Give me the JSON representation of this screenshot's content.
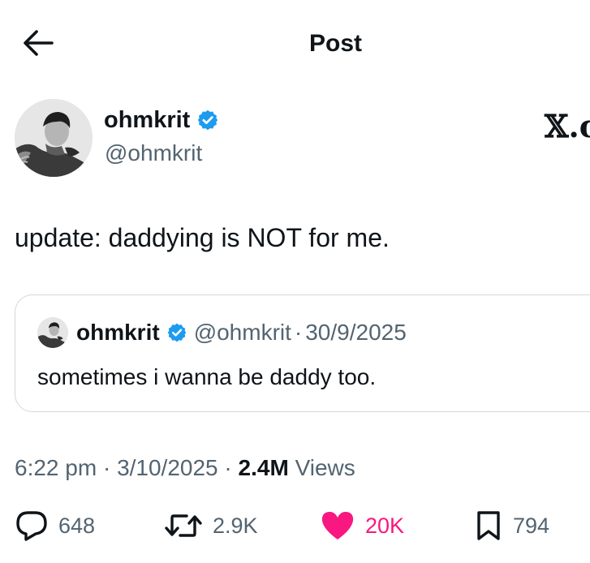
{
  "header": {
    "title": "Post"
  },
  "author": {
    "name": "ohmkrit",
    "handle": "@ohmkrit",
    "verified": true
  },
  "brand": {
    "logo_text": "𝕏.c"
  },
  "post": {
    "text": "update: daddying is NOT for me."
  },
  "quote": {
    "name": "ohmkrit",
    "handle": "@ohmkrit",
    "separator": "·",
    "date": "30/9/2025",
    "text": "sometimes i wanna be daddy too."
  },
  "meta": {
    "time": "6:22 pm",
    "separator": "·",
    "date": "3/10/2025",
    "views_count": "2.4M",
    "views_label": "Views"
  },
  "actions": {
    "reply_count": "648",
    "repost_count": "2.9K",
    "like_count": "20K",
    "bookmark_count": "794"
  },
  "colors": {
    "verified": "#1d9bf0",
    "like": "#f91880",
    "secondary_text": "#536471",
    "border": "#cfd9de"
  },
  "icons": {
    "back": "arrow-left-icon",
    "verified": "verified-badge-icon",
    "reply": "reply-icon",
    "repost": "repost-icon",
    "like": "heart-filled-icon",
    "bookmark": "bookmark-icon"
  }
}
